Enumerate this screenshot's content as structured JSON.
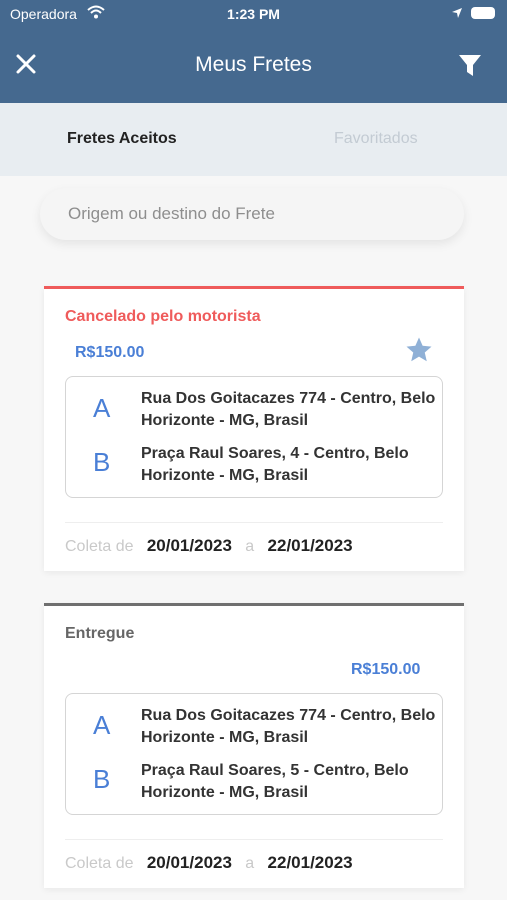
{
  "status_bar": {
    "carrier": "Operadora",
    "time": "1:23 PM"
  },
  "header": {
    "title": "Meus Fretes"
  },
  "tabs": [
    {
      "label": "Fretes Aceitos",
      "active": true
    },
    {
      "label": "Favoritados",
      "active": false
    }
  ],
  "search": {
    "placeholder": "Origem ou destino do Frete"
  },
  "freights": [
    {
      "status": "Cancelado pelo motorista",
      "price": "R$150.00",
      "favorite": true,
      "origin_letter": "A",
      "origin": "Rua Dos Goitacazes 774 - Centro, Belo Horizonte - MG, Brasil",
      "destination_letter": "B",
      "destination": "Praça Raul Soares, 4 - Centro, Belo Horizonte - MG, Brasil",
      "collect_label": "Coleta de",
      "date_from": "20/01/2023",
      "date_sep": "a",
      "date_to": "22/01/2023"
    },
    {
      "status": "Entregue",
      "price": "R$150.00",
      "favorite": false,
      "origin_letter": "A",
      "origin": "Rua Dos Goitacazes 774 - Centro, Belo Horizonte - MG, Brasil",
      "destination_letter": "B",
      "destination": "Praça Raul Soares, 5 - Centro, Belo Horizonte - MG, Brasil",
      "collect_label": "Coleta de",
      "date_from": "20/01/2023",
      "date_sep": "a",
      "date_to": "22/01/2023"
    }
  ],
  "colors": {
    "header_bg": "#45698f",
    "accent_blue": "#4a7fd6",
    "cancel_red": "#ef5b5b",
    "star_blue": "#8fb0d6"
  },
  "icons": [
    "wifi-icon",
    "location-arrow-icon",
    "battery-icon",
    "close-icon",
    "filter-icon",
    "star-icon"
  ]
}
